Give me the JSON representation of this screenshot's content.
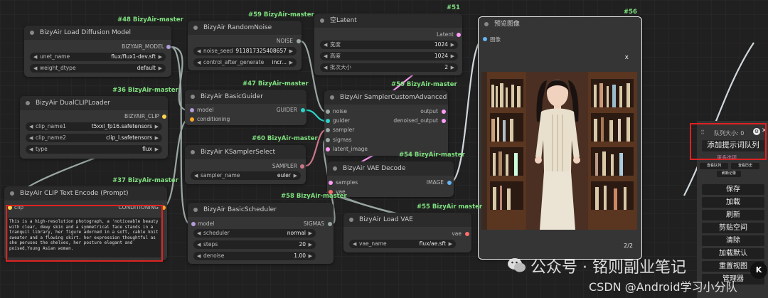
{
  "nodes": {
    "n48": {
      "badge": "#48 BizyAir-master",
      "title": "BizyAir Load Diffusion Model",
      "out": "BIZYAIR_MODEL",
      "w1": {
        "label": "unet_name",
        "value": "flux/flux1-dev.sft"
      },
      "w2": {
        "label": "weight_dtype",
        "value": "default"
      }
    },
    "n59": {
      "badge": "#59 BizyAir-master",
      "title": "BizyAir RandomNoise",
      "out": "NOISE",
      "w1": {
        "label": "noise_seed",
        "value": "911817325408657"
      },
      "w2": {
        "label": "control_after_generate",
        "value": "incr..."
      }
    },
    "n51": {
      "badge": "#51",
      "title": "空Latent",
      "out": "Latent",
      "w1": {
        "label": "宽度",
        "value": "1024"
      },
      "w2": {
        "label": "高度",
        "value": "1024"
      },
      "w3": {
        "label": "批次大小",
        "value": "2"
      }
    },
    "n56": {
      "badge": "#56",
      "title": "预览图像",
      "in": "图像",
      "close": "x",
      "counter": "2/2"
    },
    "n36": {
      "badge": "#36 BizyAir-master",
      "title": "BizyAir DualCLIPLoader",
      "out": "BIZYAIR_CLIP",
      "w1": {
        "label": "clip_name1",
        "value": "t5xxl_fp16.safetensors"
      },
      "w2": {
        "label": "clip_name2",
        "value": "clip_l.safetensors"
      },
      "w3": {
        "label": "type",
        "value": "flux"
      }
    },
    "n47": {
      "badge": "#47 BizyAir-master",
      "title": "BizyAir BasicGuider",
      "in1": "model",
      "in2": "conditioning",
      "out": "GUIDER"
    },
    "n50": {
      "badge": "#50 BizyAir-master",
      "title": "BizyAir SamplerCustomAdvanced",
      "ins": [
        "noise",
        "guider",
        "sampler",
        "sigmas",
        "latent_image"
      ],
      "out1": "output",
      "out2": "denoised_output"
    },
    "n60": {
      "badge": "#60 BizyAir-master",
      "title": "BizyAir KSamplerSelect",
      "out": "SAMPLER",
      "w1": {
        "label": "sampler_name",
        "value": "euler"
      }
    },
    "n54": {
      "badge": "#54 BizyAir-master",
      "title": "BizyAir VAE Decode",
      "in1": "samples",
      "in2": "vae",
      "out": "IMAGE"
    },
    "n37": {
      "badge": "#37 BizyAir-master",
      "title": "BizyAir CLIP Text Encode (Prompt)",
      "in": "clip",
      "out": "CONDITIONING",
      "text": "This is a high-resolution photograph, a 'noticeable beauty with clear, dewy skin and a symmetrical face stands in a tranquil library, her figure adorned in a soft, cable knit sweater and a flowing skirt. her expression thoughtful as she peruses the shelves, her posture elegant and poised,Young Asian woman."
    },
    "n58": {
      "badge": "#58 BizyAir-master",
      "title": "BizyAir BasicScheduler",
      "in": "model",
      "out": "SIGMAS",
      "w1": {
        "label": "scheduler",
        "value": "normal"
      },
      "w2": {
        "label": "steps",
        "value": "20"
      },
      "w3": {
        "label": "denoise",
        "value": "1.00"
      }
    },
    "n55": {
      "badge": "#55 BizyAir master",
      "title": "BizyAir Load VAE",
      "out": "vae",
      "w1": {
        "label": "vae_name",
        "value": "flux/ae.sft"
      }
    }
  },
  "queue_panel": {
    "queue_size": "队列大小: 0",
    "add_prompt": "添加提示词队列",
    "extra": "更多选项",
    "small1": "查看队列",
    "small2": "查看历史",
    "small3": "刷新记录",
    "buttons": [
      "保存",
      "加载",
      "刷新",
      "剪贴空间",
      "清除",
      "加载默认",
      "重置视图",
      "管理器"
    ]
  },
  "watermark": {
    "wechat": "公众号 · 铭则副业笔记",
    "csdn": "CSDN @Android学习小分队"
  },
  "colors": {
    "badge": "#7fe07f",
    "highlight": "#dd2222",
    "model": "#b39ddb",
    "clip": "#ffd54f",
    "conditioning": "#ffa726",
    "latent": "#ff9cf6",
    "image": "#64b5f6",
    "vae": "#ff6e6e"
  }
}
